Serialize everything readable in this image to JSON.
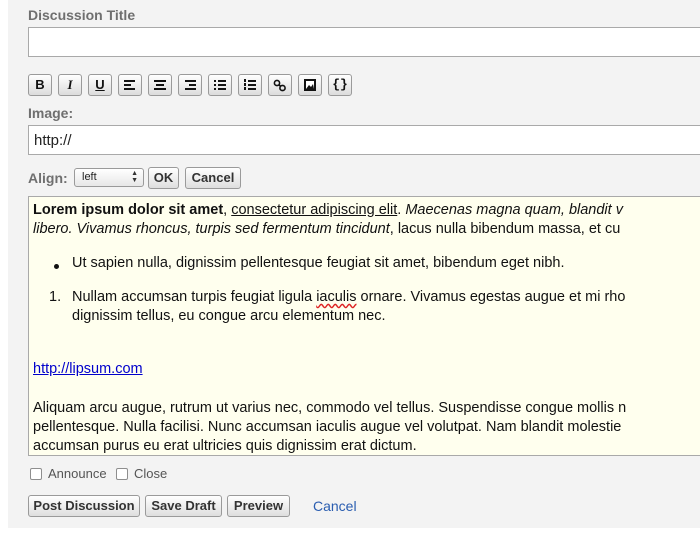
{
  "form": {
    "title_label": "Discussion Title",
    "title_value": "",
    "image_label": "Image:",
    "image_value": "http://",
    "align_label": "Align:",
    "align_selected": "left",
    "ok_label": "OK",
    "cancel_label": "Cancel"
  },
  "toolbar": {
    "buttons": [
      {
        "icon": "bold-icon",
        "glyph": "B"
      },
      {
        "icon": "italic-icon",
        "glyph": "I"
      },
      {
        "icon": "underline-icon",
        "glyph": "U"
      },
      {
        "icon": "align-left-icon"
      },
      {
        "icon": "align-center-icon"
      },
      {
        "icon": "align-right-icon"
      },
      {
        "icon": "bullet-list-icon"
      },
      {
        "icon": "numbered-list-icon"
      },
      {
        "icon": "link-icon"
      },
      {
        "icon": "image-icon"
      },
      {
        "icon": "code-icon",
        "glyph": "{}"
      }
    ]
  },
  "editor": {
    "p1_bold": "Lorem ipsum dolor sit amet",
    "p1_comma": ", ",
    "p1_underline": "consectetur adipiscing elit",
    "p1_dot": ". ",
    "p1_italic_a": "Maecenas magna quam, blandit v",
    "p1_italic_b": "libero. Vivamus rhoncus, turpis sed fermentum tincidunt",
    "p1_rest_b": ", lacus nulla bibendum massa, et cu",
    "bullet_item": "Ut sapien nulla, dignissim pellentesque feugiat sit amet, bibendum eget nibh.",
    "numbered_marker": "1.",
    "numbered_item_a": "Nullam accumsan turpis feugiat ligula ",
    "numbered_item_word": "iaculis",
    "numbered_item_b": " ornare. Vivamus egestas augue et mi rho",
    "numbered_item_c": "dignissim tellus, eu congue arcu elementum nec.",
    "link_text": "http://lipsum.com",
    "p2_line1": "Aliquam arcu augue, rutrum ut varius nec, commodo vel tellus. Suspendisse congue mollis n",
    "p2_line2": "pellentesque. Nulla facilisi. Nunc accumsan iaculis augue vel volutpat. Nam blandit molestie",
    "p2_line3": "accumsan purus eu erat ultricies quis dignissim erat dictum."
  },
  "options": {
    "announce_label": "Announce",
    "announce_checked": false,
    "close_label": "Close",
    "close_checked": false
  },
  "actions": {
    "post_label": "Post Discussion",
    "draft_label": "Save Draft",
    "preview_label": "Preview",
    "cancel_label": "Cancel"
  }
}
